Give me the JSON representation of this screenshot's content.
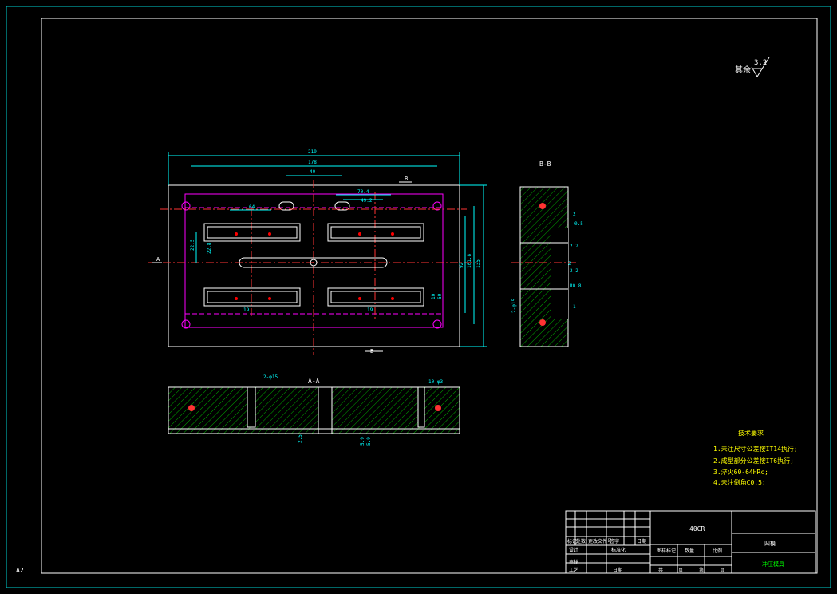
{
  "sheet": {
    "size_label": "A2",
    "surface_finish_prefix": "其余",
    "surface_finish_value": "3.2"
  },
  "top_view": {
    "dims_horizontal": [
      "219",
      "178",
      "40",
      "70.4",
      "49.2",
      "64",
      "19",
      "19"
    ],
    "dims_vertical": [
      "135",
      "101.8",
      "92",
      "22.5",
      "22.8",
      "10",
      "60"
    ],
    "section_mark_a": "A",
    "section_mark_b": "B"
  },
  "section_bb": {
    "title": "B-B",
    "callouts": [
      "2",
      "0.5",
      "2.2",
      "2",
      "2.2",
      "R0.8",
      "1",
      "2-φ15"
    ]
  },
  "section_aa": {
    "title": "A-A",
    "callouts": [
      "2-φ15",
      "10-φ3",
      "2.5",
      "5.9",
      "5.9"
    ]
  },
  "tech_requirements": {
    "title": "技术要求",
    "items": [
      "1.未注尺寸公差按IT14执行;",
      "2.成型部分公差按IT6执行;",
      "3.淬火60-64HRc;",
      "4.未注倒角C0.5;"
    ]
  },
  "title_block": {
    "material": "40CR",
    "part_name": "凹模",
    "drawing_no": "冲压模具",
    "labels_row1": [
      "标记",
      "处数",
      "更改文件号",
      "签字",
      "日期"
    ],
    "labels_row2": [
      "设计",
      "标准化"
    ],
    "labels_row3": [
      "审核"
    ],
    "labels_row4": [
      "工艺",
      "日期"
    ],
    "stage_labels": [
      "图样标记",
      "数量",
      "比例"
    ],
    "sheet_labels": [
      "共",
      "页",
      "第",
      "页"
    ]
  }
}
